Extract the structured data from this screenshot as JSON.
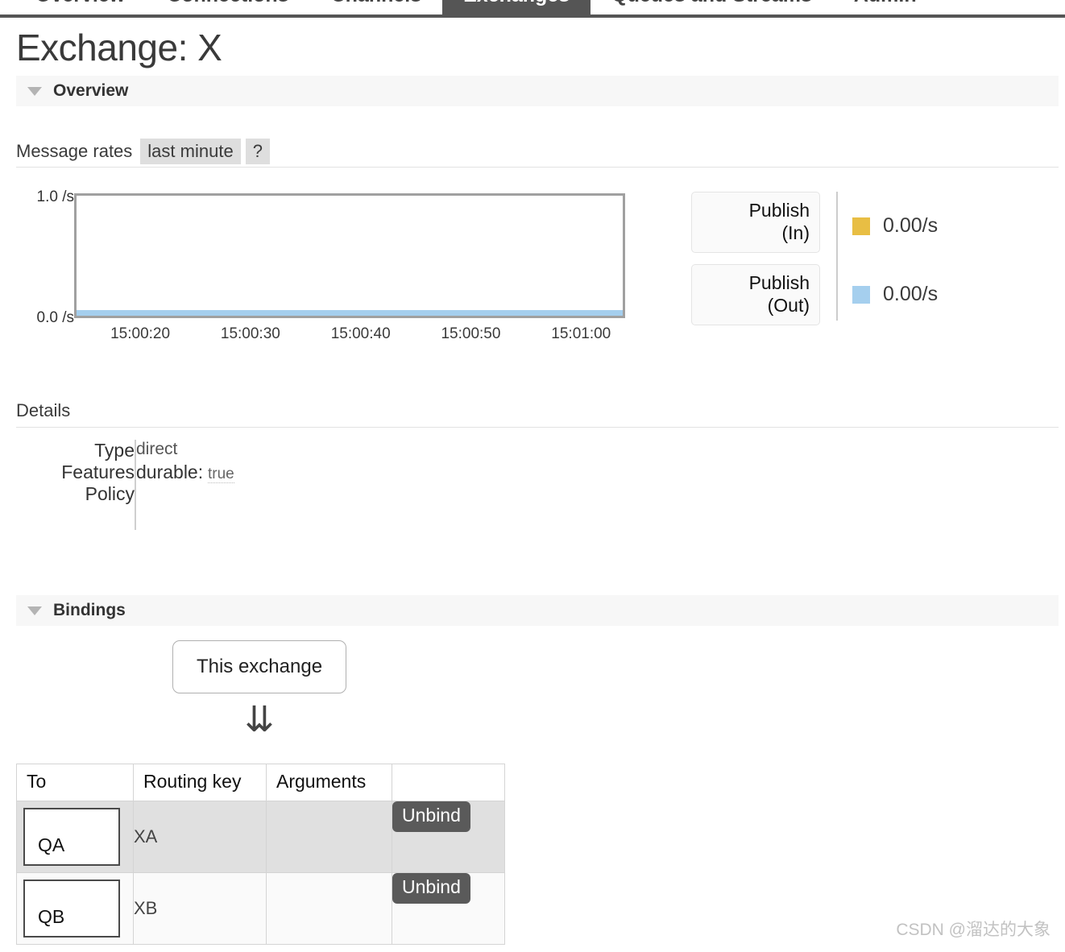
{
  "nav": {
    "tabs": [
      {
        "label": "Overview",
        "active": false
      },
      {
        "label": "Connections",
        "active": false
      },
      {
        "label": "Channels",
        "active": false
      },
      {
        "label": "Exchanges",
        "active": true
      },
      {
        "label": "Queues and Streams",
        "active": false
      },
      {
        "label": "Admin",
        "active": false
      }
    ]
  },
  "page": {
    "title": "Exchange: X"
  },
  "overview": {
    "section_label": "Overview",
    "rates": {
      "label": "Message rates",
      "period": "last minute",
      "help": "?"
    },
    "legend_buttons": [
      {
        "line1": "Publish",
        "line2": "(In)"
      },
      {
        "line1": "Publish",
        "line2": "(Out)"
      }
    ],
    "legend_values": [
      {
        "value": "0.00/s",
        "color": "#e8be44"
      },
      {
        "value": "0.00/s",
        "color": "#a5cfee"
      }
    ]
  },
  "chart_data": {
    "type": "line",
    "title": "Message rates",
    "xlabel": "",
    "ylabel": "/s",
    "ylim": [
      0.0,
      1.0
    ],
    "ytick_labels": [
      "1.0 /s",
      "0.0 /s"
    ],
    "grid": false,
    "legend_position": "right",
    "x": [
      "15:00:20",
      "15:00:30",
      "15:00:40",
      "15:00:50",
      "15:01:00"
    ],
    "series": [
      {
        "name": "Publish (In)",
        "color": "#e8be44",
        "values": [
          0.0,
          0.0,
          0.0,
          0.0,
          0.0
        ],
        "current": "0.00/s"
      },
      {
        "name": "Publish (Out)",
        "color": "#a5cfee",
        "values": [
          0.0,
          0.0,
          0.0,
          0.0,
          0.0
        ],
        "current": "0.00/s"
      }
    ]
  },
  "details": {
    "title": "Details",
    "rows": [
      {
        "key": "Type",
        "value": "direct"
      },
      {
        "key": "Features",
        "feature_name": "durable:",
        "feature_value": "true"
      },
      {
        "key": "Policy",
        "value": ""
      }
    ]
  },
  "bindings": {
    "section_label": "Bindings",
    "source_node": "This exchange",
    "arrow": "⇊",
    "columns": [
      "To",
      "Routing key",
      "Arguments",
      ""
    ],
    "rows": [
      {
        "to": "QA",
        "routing_key": "XA",
        "arguments": "",
        "action": "Unbind"
      },
      {
        "to": "QB",
        "routing_key": "XB",
        "arguments": "",
        "action": "Unbind"
      }
    ]
  },
  "watermark": "CSDN @溜达的大象"
}
